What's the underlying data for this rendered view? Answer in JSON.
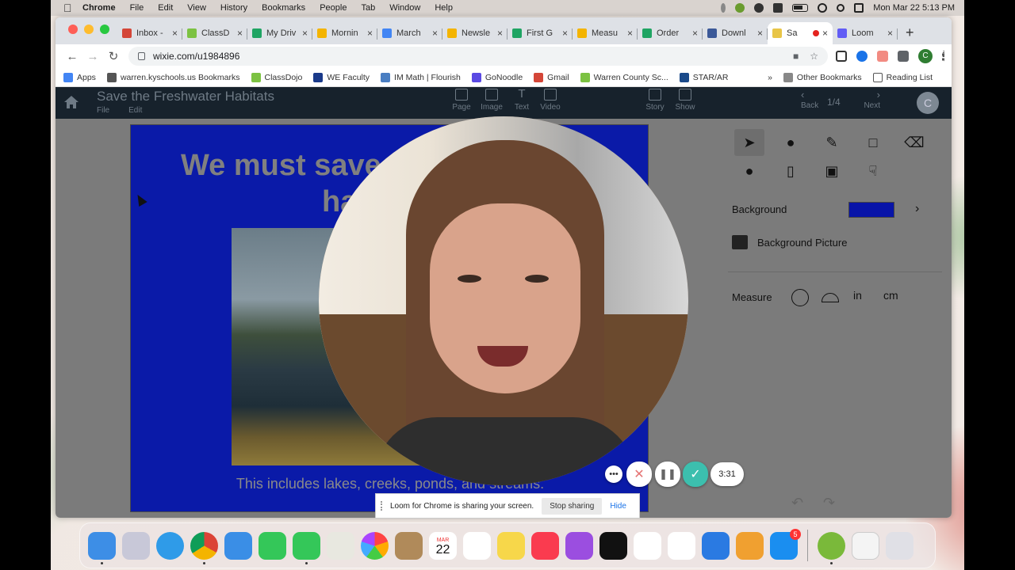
{
  "menubar": {
    "items": [
      "Chrome",
      "File",
      "Edit",
      "View",
      "History",
      "Bookmarks",
      "People",
      "Tab",
      "Window",
      "Help"
    ],
    "clock": "Mon Mar 22  5:13 PM"
  },
  "tabs": [
    {
      "label": "Inbox -",
      "color": "#d44638"
    },
    {
      "label": "ClassD",
      "color": "#7cc242"
    },
    {
      "label": "My Driv",
      "color": "#1fa463"
    },
    {
      "label": "Mornin",
      "color": "#f4b400"
    },
    {
      "label": "March",
      "color": "#4285f4"
    },
    {
      "label": "Newsle",
      "color": "#f4b400"
    },
    {
      "label": "First G",
      "color": "#1fa463"
    },
    {
      "label": "Measu",
      "color": "#f4b400"
    },
    {
      "label": "Order",
      "color": "#1fa463"
    },
    {
      "label": "Downl",
      "color": "#3b5998"
    },
    {
      "label": "Sa",
      "color": "#e8c547",
      "active": true
    },
    {
      "label": "Loom",
      "color": "#625df5"
    }
  ],
  "address": {
    "url": "wixie.com/u1984896"
  },
  "bookmarks": [
    {
      "label": "Apps",
      "color": "#4285f4"
    },
    {
      "label": "warren.kyschools.us Bookmarks",
      "color": "#555"
    },
    {
      "label": "ClassDojo",
      "color": "#7cc242"
    },
    {
      "label": "WE Faculty",
      "color": "#1a3a8a"
    },
    {
      "label": "IM Math | Flourish",
      "color": "#4a7ec2"
    },
    {
      "label": "GoNoodle",
      "color": "#5a4ae3"
    },
    {
      "label": "Gmail",
      "color": "#d44638"
    },
    {
      "label": "Warren County Sc...",
      "color": "#7cc242"
    },
    {
      "label": "STAR/AR",
      "color": "#1a4a8a"
    }
  ],
  "bookmarks_right": {
    "overflow": "»",
    "other": "Other Bookmarks",
    "reading": "Reading List"
  },
  "wixie": {
    "title": "Save the Freshwater Habitats",
    "file": "File",
    "edit": "Edit",
    "tools": [
      "Page",
      "Image",
      "Text",
      "Video"
    ],
    "story": "Story",
    "show": "Show",
    "page_counter": "1/4",
    "back": "Back",
    "next": "Next",
    "avatar": "C",
    "slide_title": "We must save t… ha…",
    "slide_title_line1": "We must save t",
    "slide_title_line2": "ha",
    "caption": "This includes lakes, creeks, ponds, and streams.",
    "panel": {
      "background_label": "Background",
      "background_color": "#0814a8",
      "background_picture": "Background Picture",
      "measure_label": "Measure",
      "in": "in",
      "cm": "cm"
    }
  },
  "loom": {
    "timer": "3:31",
    "sharing_text": "Loom for Chrome is sharing your screen.",
    "stop": "Stop sharing",
    "hide": "Hide"
  },
  "dock": {
    "calendar_month": "MAR",
    "calendar_day": "22",
    "appstore_badge": "5"
  }
}
